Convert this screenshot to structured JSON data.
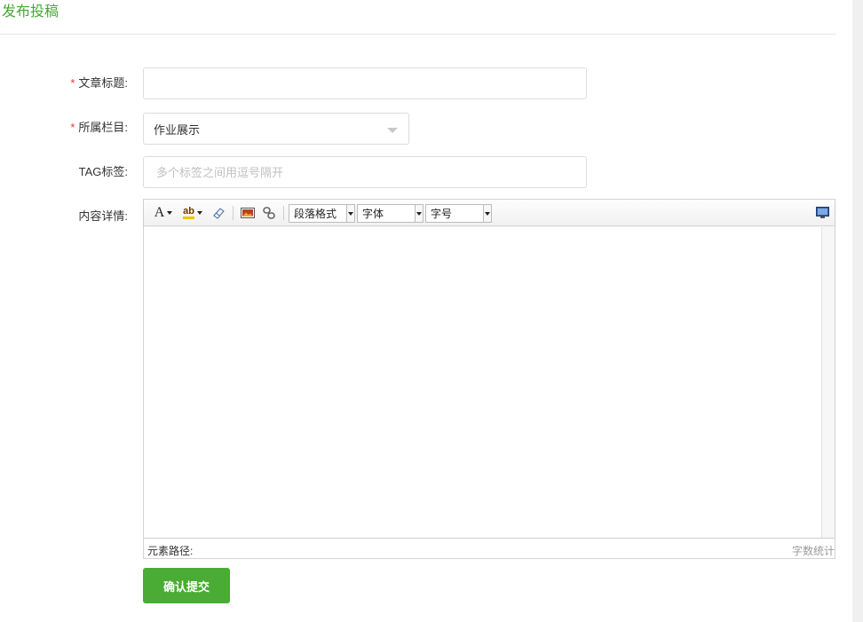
{
  "page": {
    "title": "发布投稿"
  },
  "form": {
    "required_mark": "*",
    "title_field": {
      "label": "文章标题:",
      "value": "",
      "placeholder": ""
    },
    "column_field": {
      "label": "所属栏目:",
      "selected": "作业展示"
    },
    "tag_field": {
      "label": "TAG标签:",
      "value": "",
      "placeholder": "多个标签之间用逗号隔开"
    },
    "content_field": {
      "label": "内容详情:"
    },
    "submit_label": "确认提交"
  },
  "editor": {
    "toolbar": {
      "font_color_glyph": "A",
      "highlight_glyph": "ab",
      "paragraph_format": "段落格式",
      "font_family": "字体",
      "font_size": "字号"
    },
    "status": {
      "element_path": "元素路径:",
      "word_count": "字数统计"
    }
  },
  "icons": {
    "font_color": "font-color-icon",
    "highlight": "highlight-color-icon",
    "eraser": "eraser-icon",
    "image": "image-icon",
    "link": "link-icon",
    "fullscreen": "fullscreen-icon"
  },
  "colors": {
    "accent": "#44a832",
    "button": "#4aac34",
    "required": "#e23b3b"
  }
}
